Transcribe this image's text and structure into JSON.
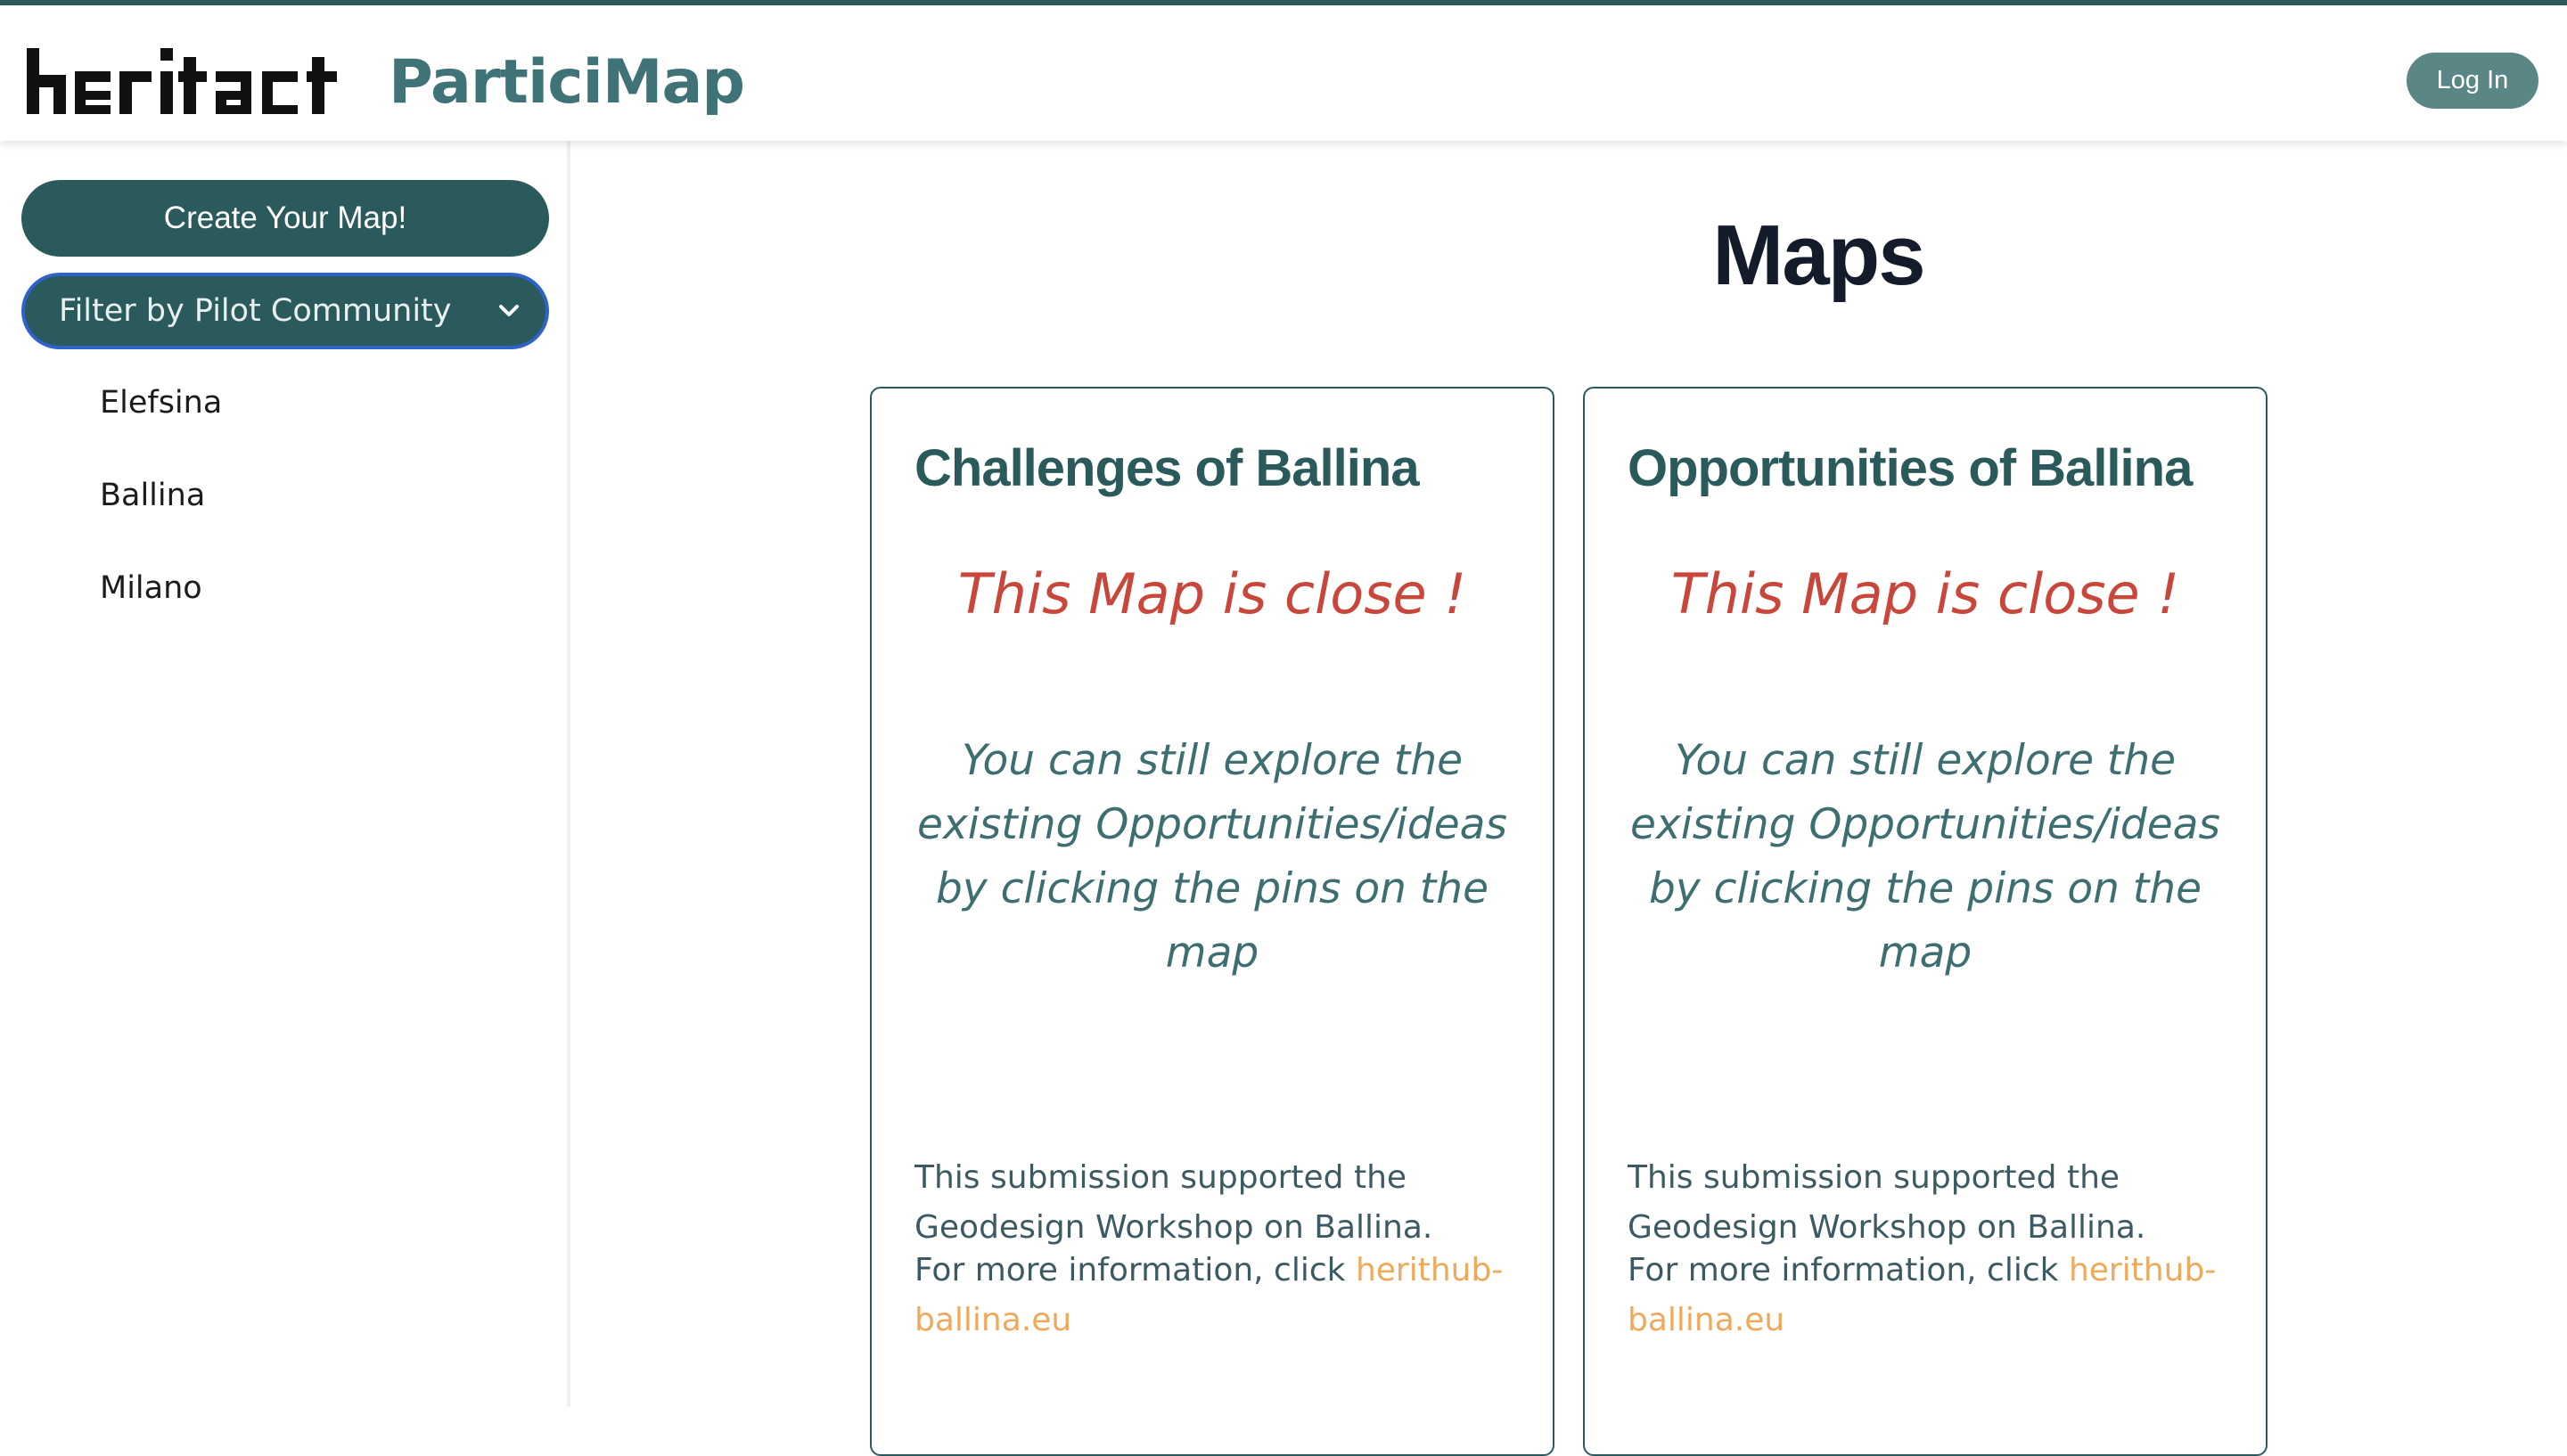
{
  "header": {
    "logo_text": "heritact",
    "brand": "ParticiMap",
    "login_label": "Log In"
  },
  "sidebar": {
    "create_label": "Create Your Map!",
    "filter_label": "Filter by Pilot Community",
    "communities": [
      "Elefsina",
      "Ballina",
      "Milano"
    ]
  },
  "main": {
    "title": "Maps",
    "cards": [
      {
        "title": "Challenges of Ballina",
        "closed": "This Map is close !",
        "explore": "You can still explore the existing Opportunities/ideas by clicking the pins on the map",
        "support": "This submission supported the Geodesign Workshop on Ballina.",
        "info_prefix": "For more information, click ",
        "link": "herithub-ballina.eu"
      },
      {
        "title": "Opportunities of Ballina",
        "closed": "This Map is close !",
        "explore": "You can still explore the existing Opportunities/ideas by clicking the pins on the map",
        "support": "This submission supported the Geodesign Workshop on Ballina.",
        "info_prefix": "For more information, click ",
        "link": "herithub-ballina.eu"
      }
    ]
  },
  "colors": {
    "primary": "#2b5a5c",
    "login": "#5b8686",
    "closed": "#c8473a",
    "explore": "#3d6f72",
    "link": "#f0a95a",
    "focus": "#2f63c8"
  },
  "icons": [
    "heritact-logo",
    "chevron-down-icon"
  ]
}
